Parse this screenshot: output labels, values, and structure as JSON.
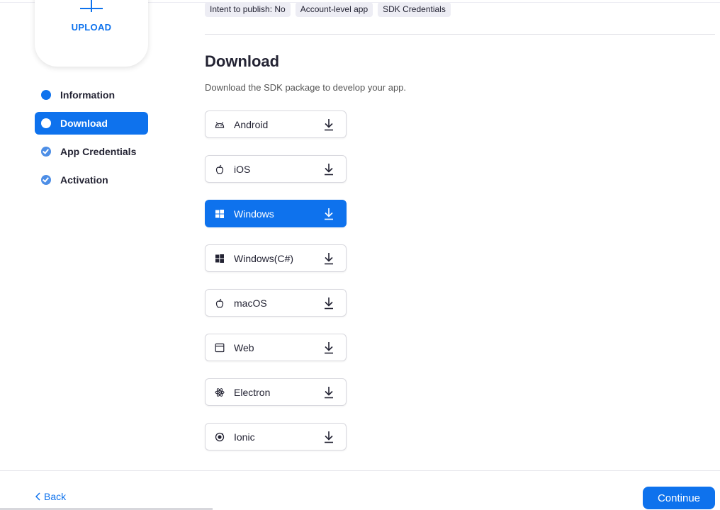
{
  "upload": {
    "label": "UPLOAD"
  },
  "steps": [
    {
      "label": "Information",
      "state": "current-dot"
    },
    {
      "label": "Download",
      "state": "active"
    },
    {
      "label": "App Credentials",
      "state": "done"
    },
    {
      "label": "Activation",
      "state": "done"
    }
  ],
  "tags": [
    "Intent to publish: No",
    "Account-level app",
    "SDK Credentials"
  ],
  "section": {
    "title": "Download",
    "description": "Download the SDK package to develop your app."
  },
  "downloads": [
    {
      "name": "Android",
      "icon": "android-icon"
    },
    {
      "name": "iOS",
      "icon": "apple-icon"
    },
    {
      "name": "Windows",
      "icon": "windows-icon",
      "selected": true
    },
    {
      "name": "Windows(C#)",
      "icon": "windows-icon"
    },
    {
      "name": "macOS",
      "icon": "apple-icon"
    },
    {
      "name": "Web",
      "icon": "browser-icon"
    },
    {
      "name": "Electron",
      "icon": "electron-icon"
    },
    {
      "name": "Ionic",
      "icon": "ionic-icon"
    }
  ],
  "footer": {
    "back_label": "Back",
    "continue_label": "Continue"
  },
  "colors": {
    "accent": "#0e72ed",
    "text": "#232333",
    "tag_bg": "#ededf4"
  }
}
